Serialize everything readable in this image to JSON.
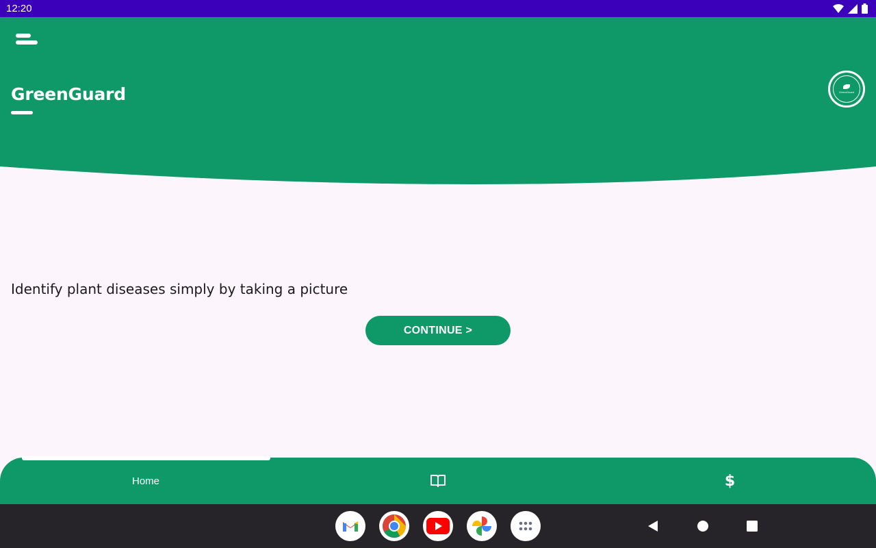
{
  "status_bar": {
    "time": "12:20",
    "icons": [
      "wifi-icon",
      "signal-icon",
      "battery-icon"
    ]
  },
  "header": {
    "app_title": "GreenGuard",
    "logo_text": "GreenGuard",
    "menu_icon": "menu-icon",
    "color": "#0f9968"
  },
  "main": {
    "tagline": "Identify plant diseases simply by taking a picture",
    "continue_label": "CONTINUE >"
  },
  "bottom_nav": {
    "items": [
      {
        "label": "Home",
        "selected": true
      },
      {
        "icon": "book-icon"
      },
      {
        "label": "$",
        "icon": "dollar-icon"
      }
    ]
  },
  "system_nav": {
    "dock_apps": [
      "gmail-icon",
      "chrome-icon",
      "youtube-icon",
      "photos-icon",
      "app-drawer-icon"
    ],
    "buttons": [
      "back-icon",
      "home-icon",
      "recents-icon"
    ]
  },
  "colors": {
    "brand_green": "#0f9968",
    "status_bar": "#3b00b9",
    "background": "#fcf6fc",
    "system_bar": "#262429"
  }
}
